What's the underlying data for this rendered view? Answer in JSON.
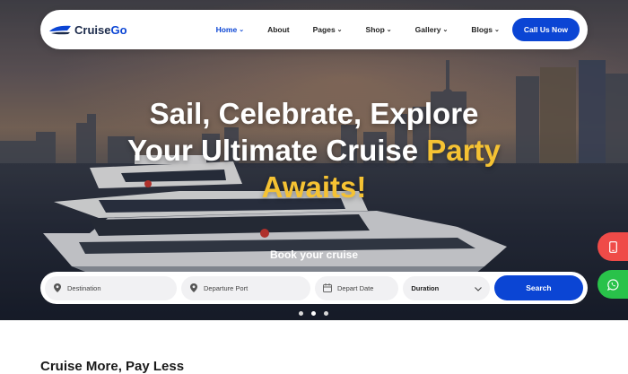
{
  "brand": {
    "name_part1": "Cruise",
    "name_part2": "Go"
  },
  "nav": {
    "items": [
      {
        "label": "Home",
        "dropdown": true,
        "active": true
      },
      {
        "label": "About",
        "dropdown": false
      },
      {
        "label": "Pages",
        "dropdown": true
      },
      {
        "label": "Shop",
        "dropdown": true
      },
      {
        "label": "Gallery",
        "dropdown": true
      },
      {
        "label": "Blogs",
        "dropdown": true
      }
    ],
    "cta_label": "Call Us Now"
  },
  "hero": {
    "line1": "Sail, Celebrate, Explore",
    "line2_white": "Your Ultimate Cruise ",
    "line2_accent": "Party",
    "line3": "Awaits!",
    "book_title": "Book your cruise"
  },
  "search": {
    "destination_placeholder": "Destination",
    "port_placeholder": "Departure Port",
    "date_placeholder": "Depart Date",
    "duration_value": "Duration",
    "button_label": "Search"
  },
  "carousel": {
    "slides": 3,
    "active": 2
  },
  "section": {
    "title": "Cruise More, Pay Less"
  },
  "colors": {
    "primary": "#0b45d4",
    "accent": "#f5c233",
    "phone": "#ef4b48",
    "whatsapp": "#29c24a"
  },
  "icons": [
    "logo-ship-icon",
    "chevron-down-icon",
    "map-pin-icon",
    "calendar-icon",
    "phone-icon",
    "whatsapp-icon"
  ]
}
